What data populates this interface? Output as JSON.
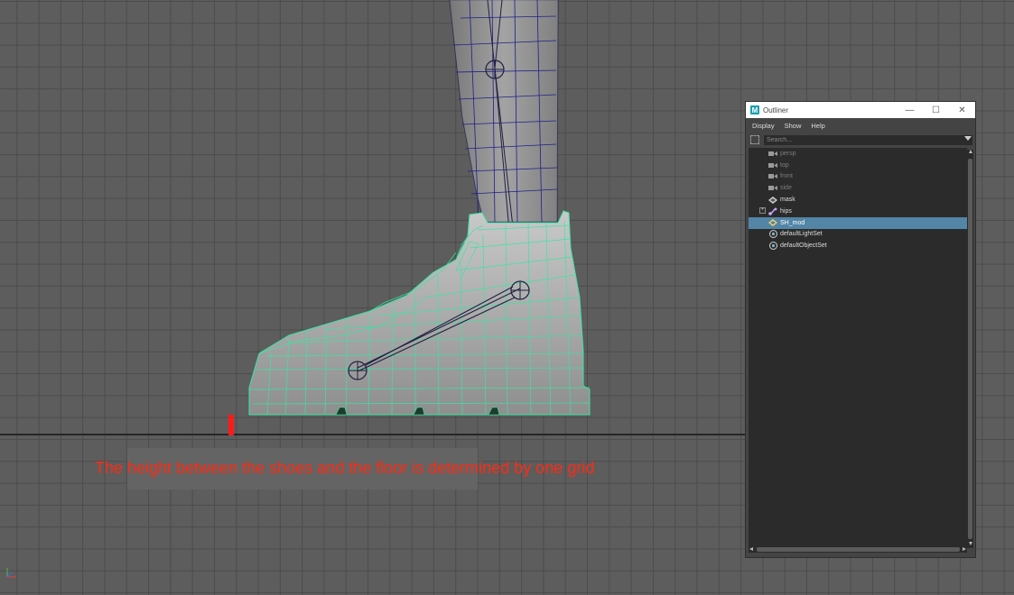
{
  "viewport": {
    "annotation": "The height between the shoes and the floor is determined by one grid",
    "annotation_color": "#ff2a12",
    "floor_marker_color": "#ff1a1a",
    "mesh_wire_color": "#37e6a0",
    "joint_color": "#1c1c6e"
  },
  "outliner": {
    "title": "Outliner",
    "app_icon_letter": "M",
    "window_controls": {
      "minimize": "—",
      "maximize": "☐",
      "close": "✕"
    },
    "menus": [
      "Display",
      "Show",
      "Help"
    ],
    "search_placeholder": "Search...",
    "selected_color": "#5285a6",
    "items": [
      {
        "label": "persp",
        "icon": "camera-icon",
        "dim": true,
        "expandable": false,
        "selected": false
      },
      {
        "label": "top",
        "icon": "camera-icon",
        "dim": true,
        "expandable": false,
        "selected": false
      },
      {
        "label": "front",
        "icon": "camera-icon",
        "dim": true,
        "expandable": false,
        "selected": false
      },
      {
        "label": "side",
        "icon": "camera-icon",
        "dim": true,
        "expandable": false,
        "selected": false
      },
      {
        "label": "mask",
        "icon": "group-icon",
        "dim": false,
        "expandable": false,
        "selected": false
      },
      {
        "label": "hips",
        "icon": "joint-icon",
        "dim": false,
        "expandable": true,
        "selected": false
      },
      {
        "label": "SH_mod",
        "icon": "group-icon",
        "dim": false,
        "expandable": false,
        "selected": true
      },
      {
        "label": "defaultLightSet",
        "icon": "set-icon",
        "dim": false,
        "expandable": false,
        "selected": false
      },
      {
        "label": "defaultObjectSet",
        "icon": "set-icon",
        "dim": false,
        "expandable": false,
        "selected": false
      }
    ]
  }
}
